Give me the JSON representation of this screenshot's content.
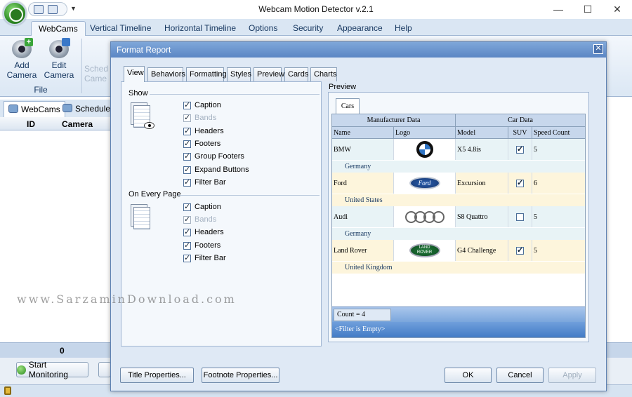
{
  "app": {
    "title": "Webcam Motion Detector v.2.1",
    "window_controls": [
      "—",
      "☐",
      "✕"
    ],
    "ribbon_tabs": [
      "WebCams",
      "Vertical Timeline",
      "Horizontal Timeline",
      "Options",
      "Security",
      "Appearance",
      "Help"
    ],
    "ribbon": {
      "add_camera": "Add\nCamera",
      "edit_camera": "Edit\nCamera",
      "group_label": "File",
      "faded": "Sched\nCame"
    },
    "subtabs": [
      "WebCams",
      "Scheduler"
    ],
    "grid": {
      "col_id": "ID",
      "col_camera": "Camera Nam",
      "footer_value": "0"
    },
    "start_monitoring": "Start Monitoring"
  },
  "dialog": {
    "title": "Format Report",
    "close": "✕",
    "tabs": [
      "View",
      "Behaviors",
      "Formatting",
      "Styles",
      "Preview",
      "Cards",
      "Charts"
    ],
    "show_label": "Show",
    "show_items": [
      {
        "label": "Caption",
        "checked": true,
        "disabled": false
      },
      {
        "label": "Bands",
        "checked": true,
        "disabled": true
      },
      {
        "label": "Headers",
        "checked": true,
        "disabled": false
      },
      {
        "label": "Footers",
        "checked": true,
        "disabled": false
      },
      {
        "label": "Group Footers",
        "checked": true,
        "disabled": false
      },
      {
        "label": "Expand Buttons",
        "checked": true,
        "disabled": false
      },
      {
        "label": "Filter Bar",
        "checked": true,
        "disabled": false
      }
    ],
    "every_page_label": "On Every Page",
    "every_page_items": [
      {
        "label": "Caption",
        "checked": true,
        "disabled": false
      },
      {
        "label": "Bands",
        "checked": true,
        "disabled": true
      },
      {
        "label": "Headers",
        "checked": true,
        "disabled": false
      },
      {
        "label": "Footers",
        "checked": true,
        "disabled": false
      },
      {
        "label": "Filter Bar",
        "checked": true,
        "disabled": false
      }
    ],
    "preview_label": "Preview",
    "preview_tab": "Cars",
    "band_manufacturer": "Manufacturer Data",
    "band_car": "Car Data",
    "columns": [
      "Name",
      "Logo",
      "Model",
      "SUV",
      "Speed Count"
    ],
    "rows": [
      {
        "name": "BMW",
        "logo": "bmw-logo",
        "model": "X5 4.8is",
        "suv": true,
        "speed": "5",
        "country": "Germany"
      },
      {
        "name": "Ford",
        "logo": "ford-logo",
        "model": "Excursion",
        "suv": true,
        "speed": "6",
        "country": "United States"
      },
      {
        "name": "Audi",
        "logo": "audi-logo",
        "model": "S8 Quattro",
        "suv": false,
        "speed": "5",
        "country": "Germany"
      },
      {
        "name": "Land Rover",
        "logo": "land-rover-logo",
        "model": "G4 Challenge",
        "suv": true,
        "speed": "5",
        "country": "United Kingdom"
      }
    ],
    "ford_text": "Ford",
    "lr_text": "LAND\nROVER",
    "count_text": "Count = 4",
    "filter_text": "<Filter is Empty>",
    "buttons": {
      "title_properties": "Title Properties...",
      "footnote_properties": "Footnote Properties...",
      "ok": "OK",
      "cancel": "Cancel",
      "apply": "Apply"
    }
  },
  "watermark": "www.SarzaminDownload.com",
  "colors": {
    "ribbon_bg": "#dae6f3",
    "dialog_bg": "#dfe9f5",
    "dialog_title": "#5b86c4",
    "band_header": "#c7d7ec",
    "row_alt": "#fdf5dc",
    "row_plain": "#e8f3f6",
    "group_text": "#15365f",
    "footer_blue": "#5b8fd0"
  }
}
